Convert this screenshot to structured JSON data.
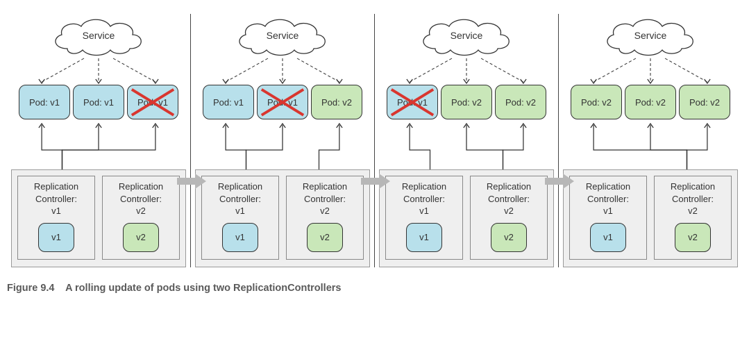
{
  "caption_prefix": "Figure 9.4",
  "caption_text": "A rolling update of pods using two ReplicationControllers",
  "service_label": "Service",
  "rc_label_line1": "Replication",
  "rc_label_line2": "Controller:",
  "versions": {
    "v1": "v1",
    "v2": "v2"
  },
  "colors": {
    "v1": "#b8e0eb",
    "v2": "#c9e7b9",
    "x": "#d9362f",
    "arrow": "#b7b7b7"
  },
  "stages": [
    {
      "pods": [
        {
          "label": "Pod: v1",
          "version": "v1",
          "x": false
        },
        {
          "label": "Pod: v1",
          "version": "v1",
          "x": false
        },
        {
          "label": "Pod: v1",
          "version": "v1",
          "x": true
        }
      ],
      "rcs": [
        {
          "version": "v1",
          "chip": "v1",
          "managed": [
            0,
            1,
            2
          ]
        },
        {
          "version": "v2",
          "chip": "v2",
          "managed": []
        }
      ]
    },
    {
      "pods": [
        {
          "label": "Pod: v1",
          "version": "v1",
          "x": false
        },
        {
          "label": "Pod: v1",
          "version": "v1",
          "x": true
        },
        {
          "label": "Pod: v2",
          "version": "v2",
          "x": false
        }
      ],
      "rcs": [
        {
          "version": "v1",
          "chip": "v1",
          "managed": [
            0,
            1
          ]
        },
        {
          "version": "v2",
          "chip": "v2",
          "managed": [
            2
          ]
        }
      ]
    },
    {
      "pods": [
        {
          "label": "Pod: v1",
          "version": "v1",
          "x": true
        },
        {
          "label": "Pod: v2",
          "version": "v2",
          "x": false
        },
        {
          "label": "Pod: v2",
          "version": "v2",
          "x": false
        }
      ],
      "rcs": [
        {
          "version": "v1",
          "chip": "v1",
          "managed": [
            0
          ]
        },
        {
          "version": "v2",
          "chip": "v2",
          "managed": [
            1,
            2
          ]
        }
      ]
    },
    {
      "pods": [
        {
          "label": "Pod: v2",
          "version": "v2",
          "x": false
        },
        {
          "label": "Pod: v2",
          "version": "v2",
          "x": false
        },
        {
          "label": "Pod: v2",
          "version": "v2",
          "x": false
        }
      ],
      "rcs": [
        {
          "version": "v1",
          "chip": "v1",
          "managed": []
        },
        {
          "version": "v2",
          "chip": "v2",
          "managed": [
            0,
            1,
            2
          ]
        }
      ]
    }
  ]
}
